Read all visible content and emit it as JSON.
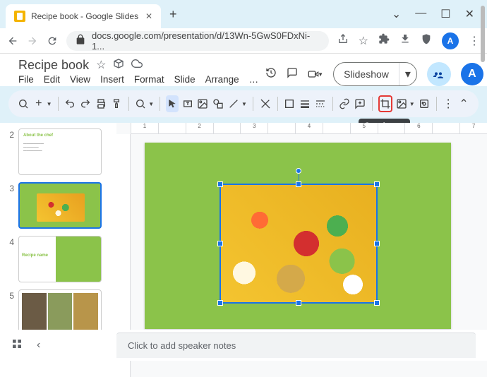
{
  "browser": {
    "tab_title": "Recipe book - Google Slides",
    "url": "docs.google.com/presentation/d/13Wn-5GwS0FDxNi-1...",
    "avatar_letter": "A"
  },
  "app": {
    "doc_title": "Recipe book",
    "menus": [
      "File",
      "Edit",
      "View",
      "Insert",
      "Format",
      "Slide",
      "Arrange",
      "…"
    ],
    "slideshow_label": "Slideshow",
    "avatar_letter": "A"
  },
  "tooltip": "Crop image",
  "ruler": [
    "1",
    "",
    "2",
    "",
    "3",
    "",
    "4",
    "",
    "5",
    "",
    "6",
    "",
    "7"
  ],
  "filmstrip": [
    {
      "num": "2",
      "type": "white_green_text"
    },
    {
      "num": "3",
      "type": "green_food",
      "active": true
    },
    {
      "num": "4",
      "type": "green_recipe"
    },
    {
      "num": "5",
      "type": "white_images"
    }
  ],
  "notes_placeholder": "Click to add speaker notes",
  "thumbs": {
    "t2_title": "About the chef",
    "t4_title": "Recipe name"
  }
}
